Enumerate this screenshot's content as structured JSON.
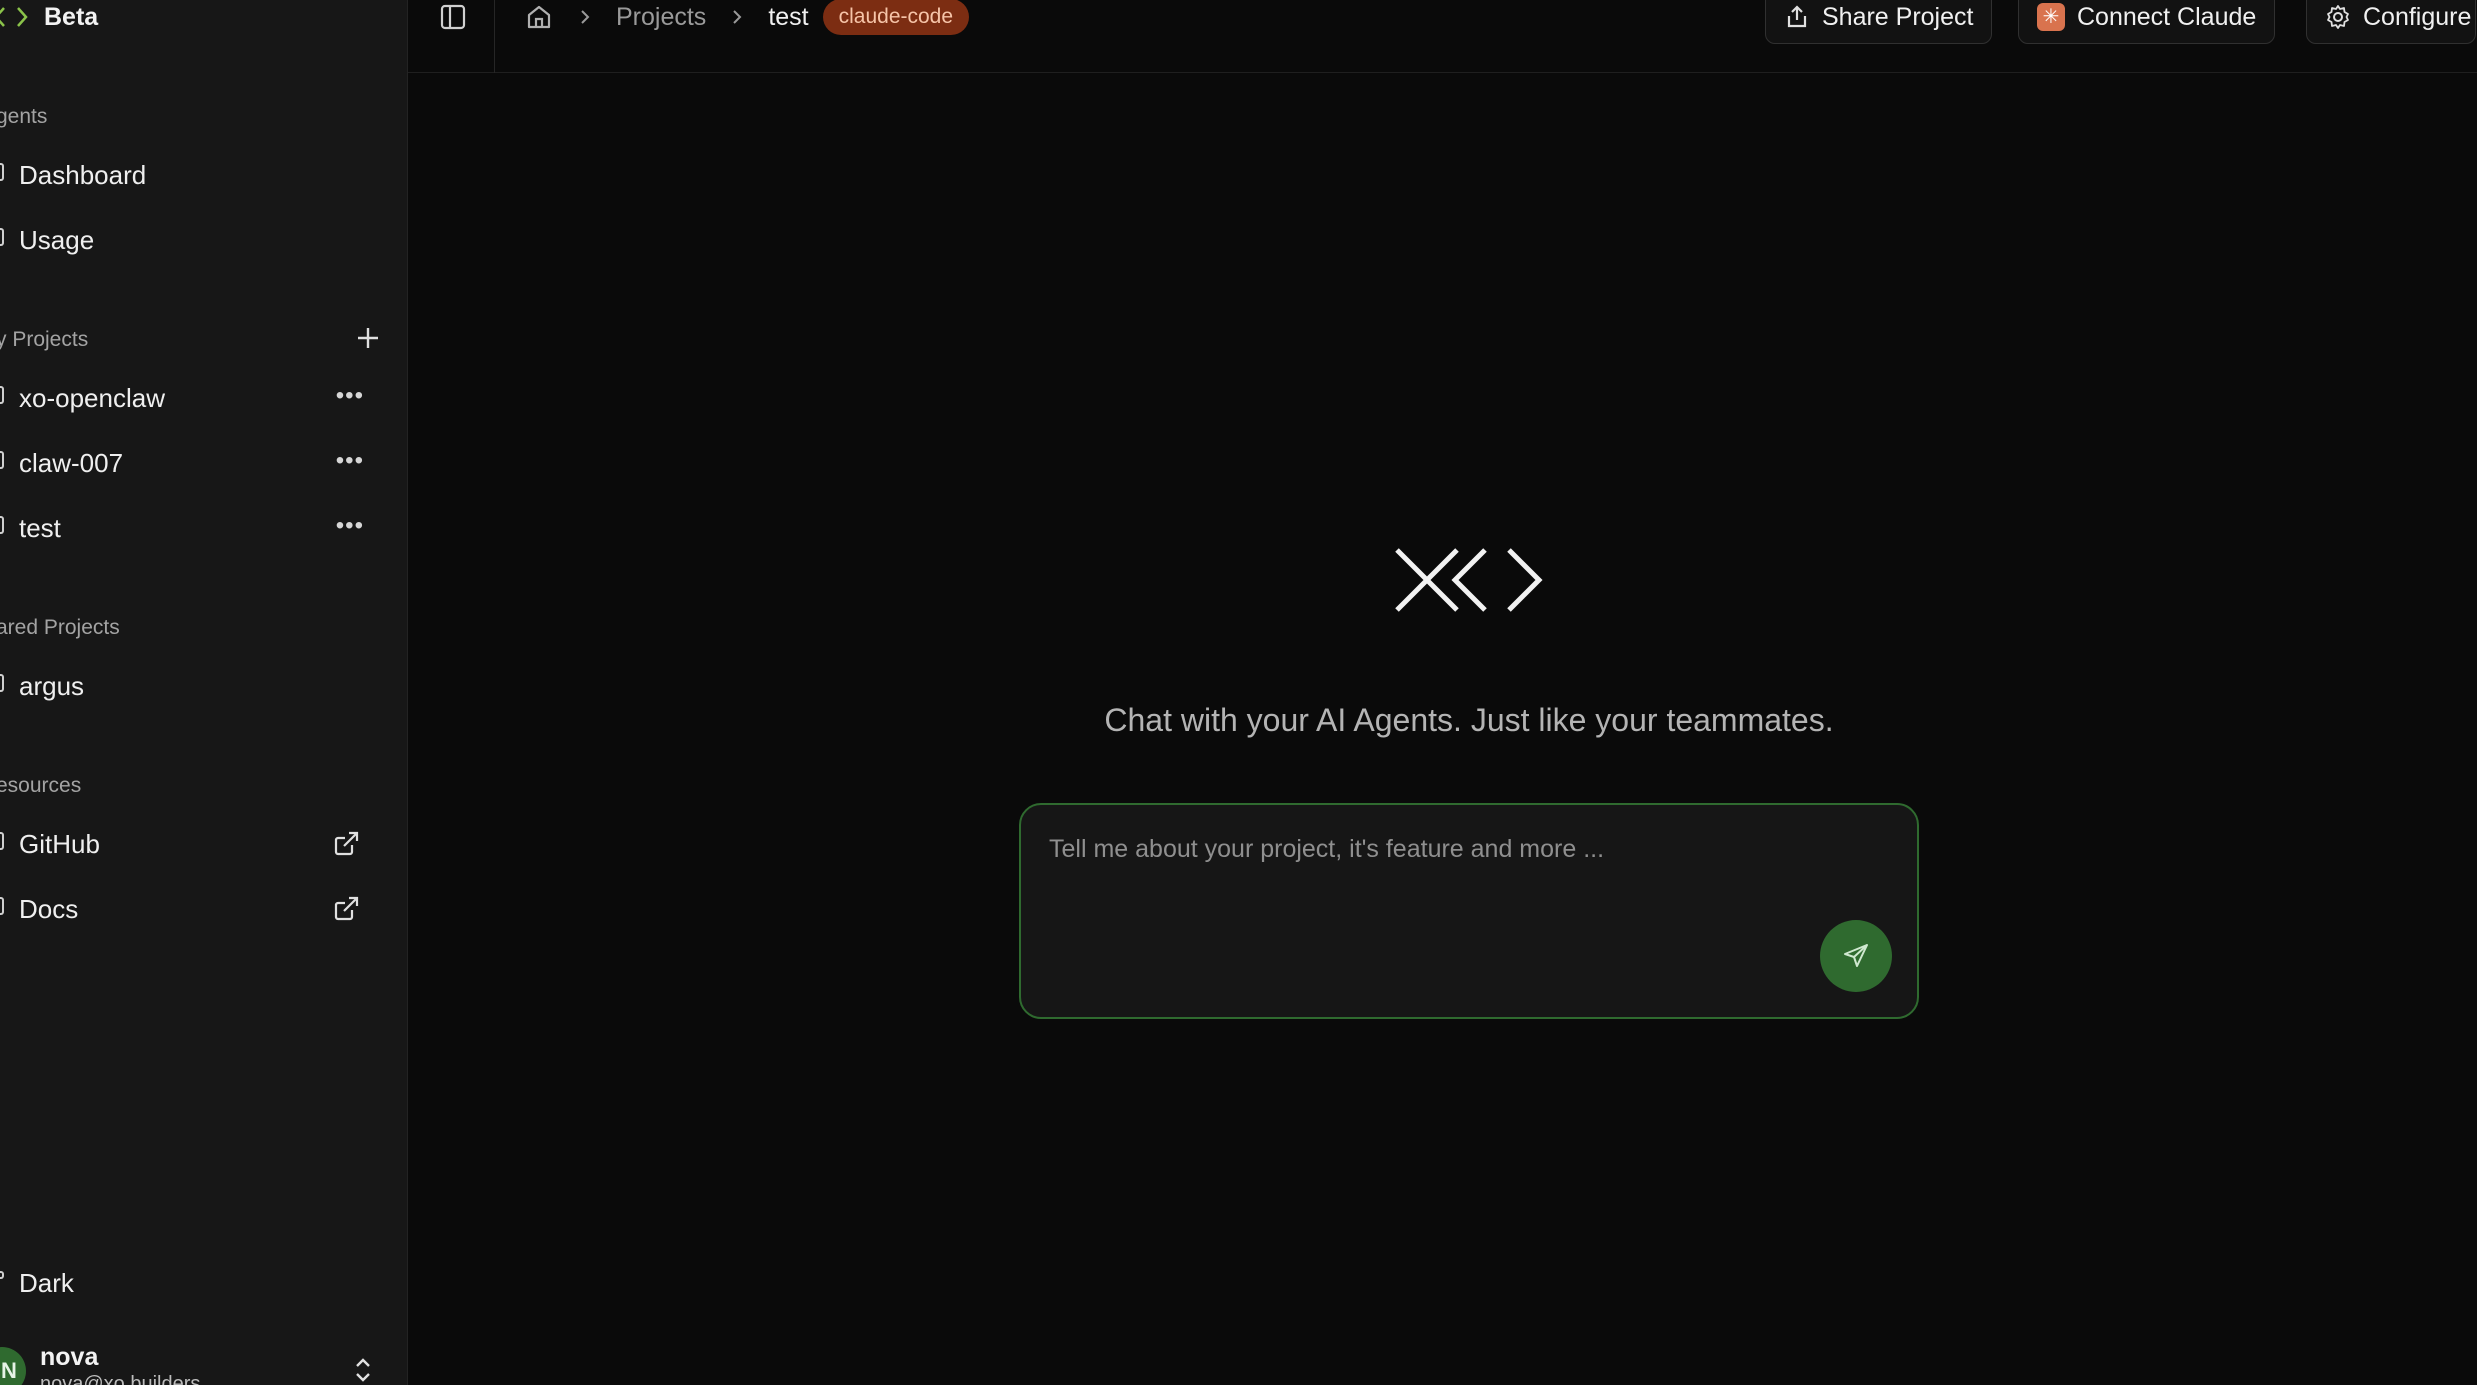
{
  "brand": {
    "label": "Beta"
  },
  "sidebar": {
    "agents_label": "gents",
    "agents": [
      {
        "label": "Dashboard"
      },
      {
        "label": "Usage"
      }
    ],
    "projects_label": "y Projects",
    "projects": [
      {
        "label": "xo-openclaw"
      },
      {
        "label": "claw-007"
      },
      {
        "label": "test"
      }
    ],
    "shared_label": "ared Projects",
    "shared": [
      {
        "label": "argus"
      }
    ],
    "resources_label": "esources",
    "resources": [
      {
        "label": "GitHub"
      },
      {
        "label": "Docs"
      }
    ],
    "theme_label": "Dark",
    "user": {
      "initial": "N",
      "name": "nova",
      "email": "nova@xo.builders"
    }
  },
  "breadcrumb": {
    "projects": "Projects",
    "current": "test",
    "badge": "claude-code"
  },
  "toolbar": {
    "share": "Share Project",
    "connect": "Connect Claude",
    "configure": "Configure"
  },
  "main": {
    "tagline": "Chat with your AI Agents. Just like your teammates.",
    "input_placeholder": "Tell me about your project, it's feature and more ..."
  },
  "colors": {
    "accent": "#2f6a2f",
    "badge": "#7c2d12",
    "claude": "#d9734e"
  }
}
